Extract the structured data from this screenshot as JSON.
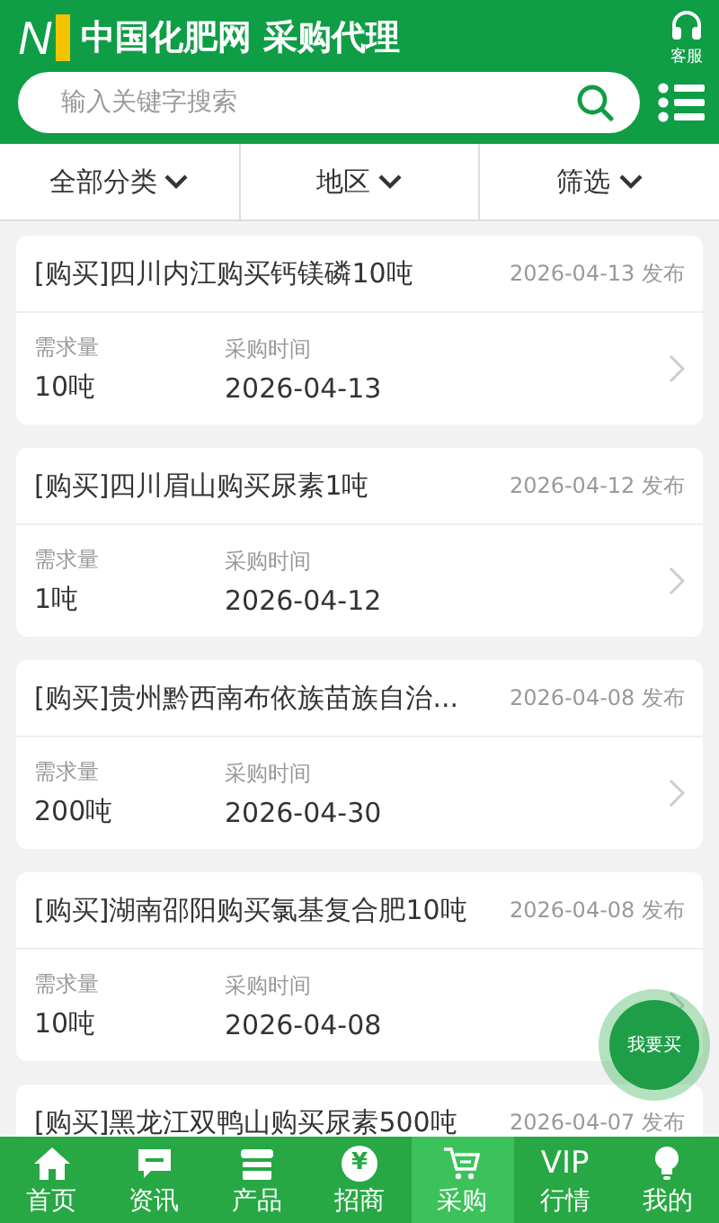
{
  "header": {
    "logo": "N",
    "title": "中国化肥网 采购代理",
    "service_label": "客服",
    "search": {
      "placeholder": "输入关键字搜索"
    }
  },
  "filters": [
    {
      "label": "全部分类"
    },
    {
      "label": "地区"
    },
    {
      "label": "筛选"
    }
  ],
  "listings": [
    {
      "title": "[购买]四川内江购买钙镁磷10吨",
      "posted": "2026-04-13 发布",
      "qty_label": "需求量",
      "qty": "10吨",
      "time_label": "采购时间",
      "time": "2026-04-13"
    },
    {
      "title": "[购买]四川眉山购买尿素1吨",
      "posted": "2026-04-12 发布",
      "qty_label": "需求量",
      "qty": "1吨",
      "time_label": "采购时间",
      "time": "2026-04-12"
    },
    {
      "title": "[购买]贵州黔西南布依族苗族自治...",
      "posted": "2026-04-08 发布",
      "qty_label": "需求量",
      "qty": "200吨",
      "time_label": "采购时间",
      "time": "2026-04-30"
    },
    {
      "title": "[购买]湖南邵阳购买氯基复合肥10吨",
      "posted": "2026-04-08 发布",
      "qty_label": "需求量",
      "qty": "10吨",
      "time_label": "采购时间",
      "time": "2026-04-08"
    },
    {
      "title": "[购买]黑龙江双鸭山购买尿素500吨",
      "posted": "2026-04-07 发布"
    }
  ],
  "fab": {
    "label": "我要买"
  },
  "nav": [
    {
      "kind": "home",
      "label": "首页",
      "selected": false
    },
    {
      "kind": "chat",
      "label": "资讯",
      "selected": false
    },
    {
      "kind": "store",
      "label": "产品",
      "selected": false
    },
    {
      "kind": "coin",
      "icon_text": "¥",
      "label": "招商",
      "selected": false
    },
    {
      "kind": "cart",
      "label": "采购",
      "selected": true
    },
    {
      "kind": "text",
      "icon_text": "VIP",
      "label": "行情",
      "selected": false
    },
    {
      "kind": "bulb",
      "label": "我的",
      "selected": false
    }
  ]
}
